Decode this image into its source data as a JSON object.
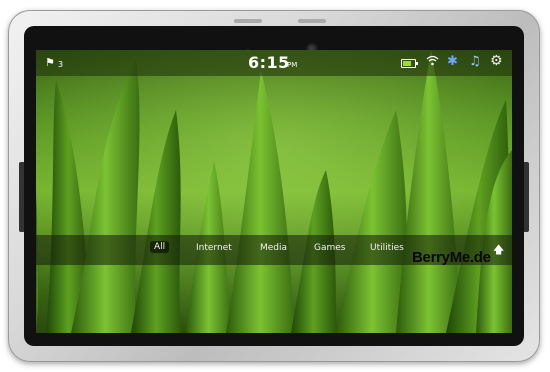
{
  "status_bar": {
    "notification_count": "3",
    "time": "6:15",
    "ampm": "PM",
    "battery_level": 0.7,
    "icons": {
      "flag": "flag-icon",
      "wifi": "wifi-icon",
      "bluetooth": "bluetooth-icon",
      "media": "music-note-icon",
      "settings": "gear-icon"
    }
  },
  "nav": {
    "tabs": [
      {
        "label": "All",
        "active": true
      },
      {
        "label": "Internet",
        "active": false
      },
      {
        "label": "Media",
        "active": false
      },
      {
        "label": "Games",
        "active": false
      },
      {
        "label": "Utilities",
        "active": false
      }
    ],
    "expand_icon": "up-arrow-icon"
  },
  "watermark": "BerryMe.de",
  "colors": {
    "bluetooth": "#6fa8ff",
    "battery_fill": "#9ae02a"
  }
}
